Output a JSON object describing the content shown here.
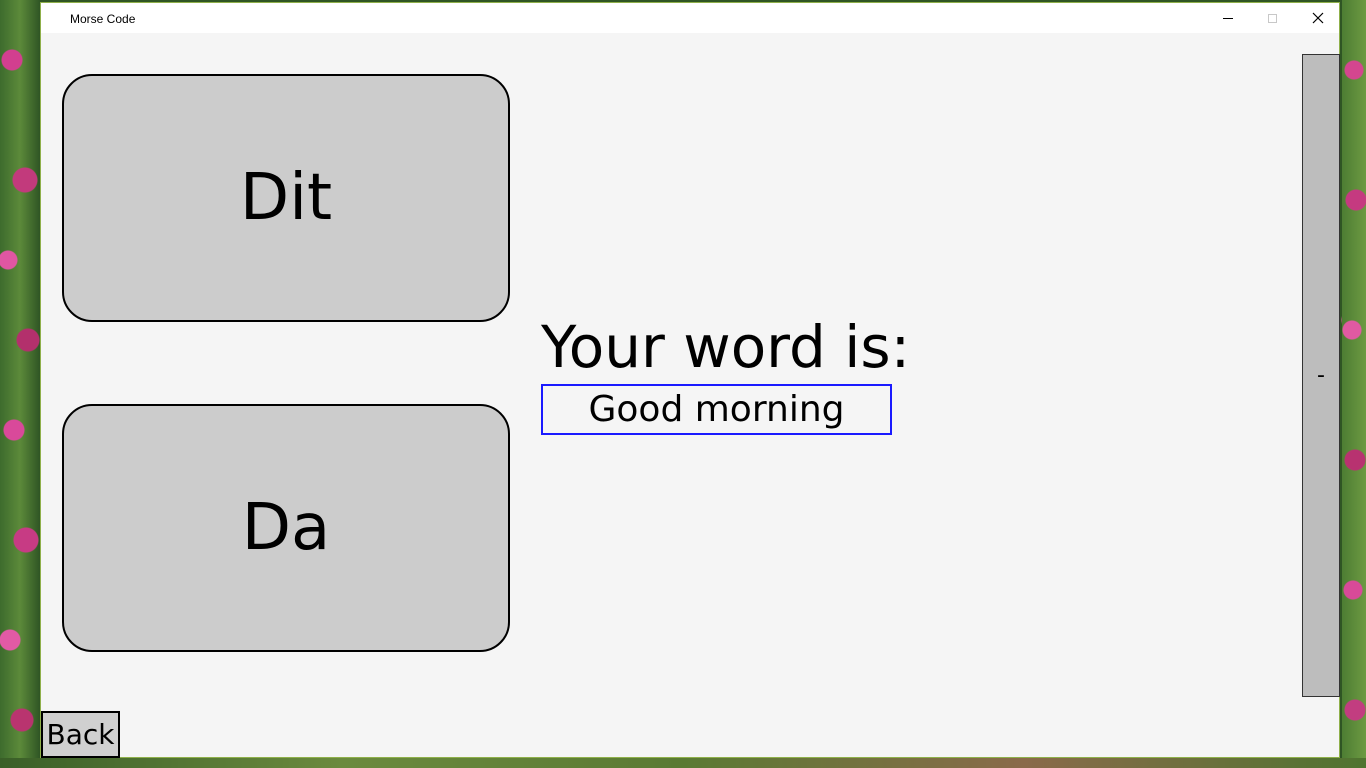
{
  "window": {
    "title": "Morse Code"
  },
  "buttons": {
    "dit_label": "Dit",
    "da_label": "Da",
    "back_label": "Back"
  },
  "prompt": {
    "label": "Your word is:",
    "word": "Good morning"
  },
  "side_panel": {
    "text": "-"
  },
  "colors": {
    "content_background": "#f5f5f5",
    "button_fill": "#cccccc",
    "word_box_border": "#1a1aff",
    "side_panel_fill": "#bdbdbd"
  },
  "icons": {
    "minimize": "minimize-icon",
    "maximize": "maximize-icon",
    "close": "close-icon"
  }
}
